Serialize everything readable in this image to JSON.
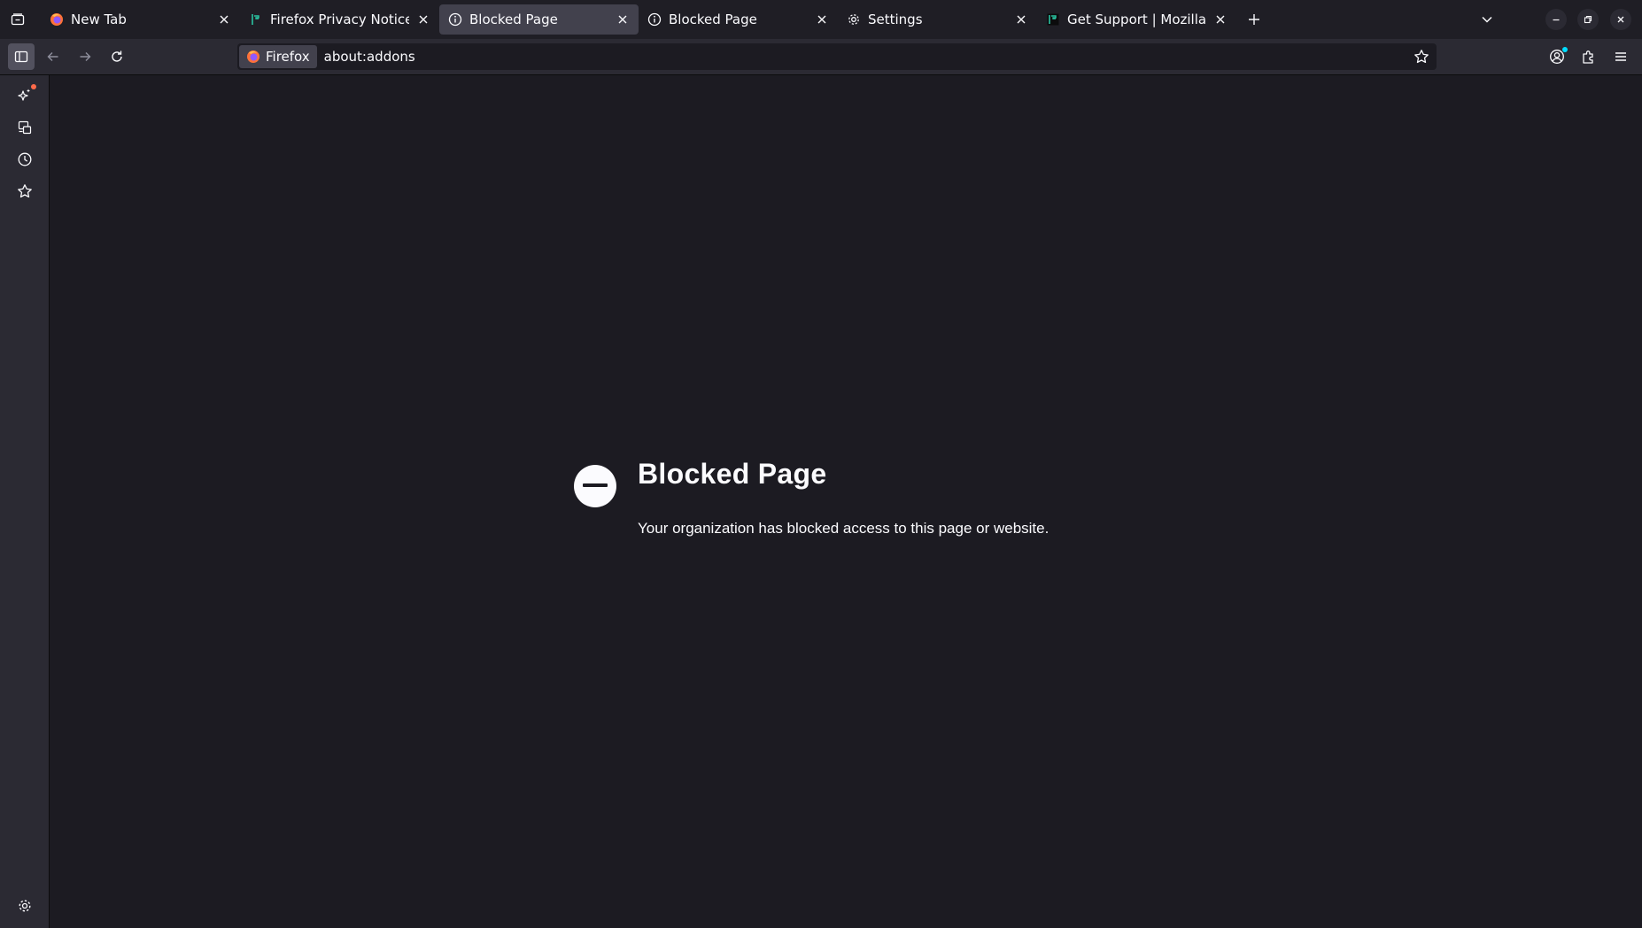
{
  "tabs": [
    {
      "title": "New Tab",
      "favicon": "firefox-icon",
      "selected": false
    },
    {
      "title": "Firefox Privacy Notice — Mozilla",
      "favicon": "mozilla-green-icon",
      "selected": false
    },
    {
      "title": "Blocked Page",
      "favicon": "info-icon",
      "selected": true
    },
    {
      "title": "Blocked Page",
      "favicon": "info-icon",
      "selected": false
    },
    {
      "title": "Settings",
      "favicon": "gear-icon",
      "selected": false
    },
    {
      "title": "Get Support | Mozilla Support",
      "favicon": "mozilla-green-icon",
      "selected": false
    }
  ],
  "urlbar": {
    "identity_label": "Firefox",
    "url": "about:addons"
  },
  "page": {
    "title": "Blocked Page",
    "description": "Your organization has blocked access to this page or website."
  },
  "colors": {
    "background": "#1c1b22",
    "toolbar": "#2b2a33",
    "selected_tab": "#42414d",
    "notification_dot": "#ff6a4a"
  }
}
